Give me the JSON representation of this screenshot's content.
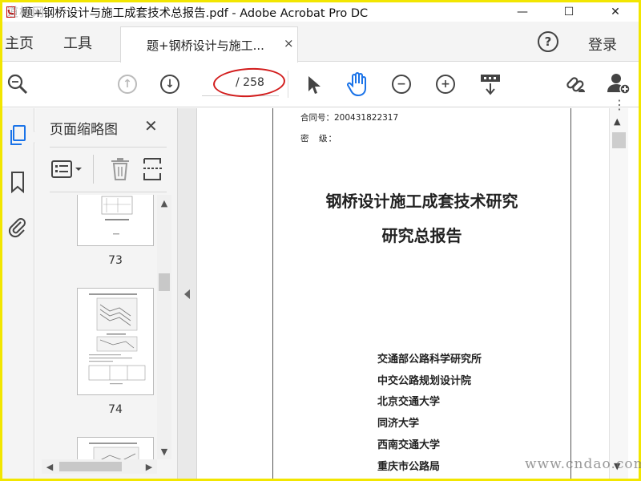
{
  "window": {
    "title": "题+钢桥设计与施工成套技术总报告.pdf - Adobe Acrobat Pro DC",
    "watermark_top": "道桥网",
    "minimize": "—",
    "maximize": "☐",
    "close": "✕"
  },
  "tabs": {
    "home": "主页",
    "tools": "工具",
    "document": "题+钢桥设计与施工...",
    "document_close": "×"
  },
  "header_right": {
    "help": "?",
    "login": "登录"
  },
  "toolbar": {
    "page_total": "/ 258",
    "highlight_color": "#d21c1c"
  },
  "thumbnails_panel": {
    "title": "页面缩略图",
    "close": "✕",
    "pages": [
      {
        "label": "73"
      },
      {
        "label": "74"
      },
      {
        "label": ""
      }
    ]
  },
  "document": {
    "contract_no": "合同号：200431822317",
    "secret_level": "密　级：",
    "title_line1": "钢桥设计施工成套技术研究",
    "title_line2": "研究总报告",
    "institutions": [
      "交通部公路科学研究所",
      "中交公路规划设计院",
      "北京交通大学",
      "同济大学",
      "西南交通大学",
      "重庆市公路局"
    ]
  },
  "watermark_bottom": "www.cndao.com",
  "colors": {
    "frame": "#f2e600",
    "active_hand": "#1a73e8"
  }
}
